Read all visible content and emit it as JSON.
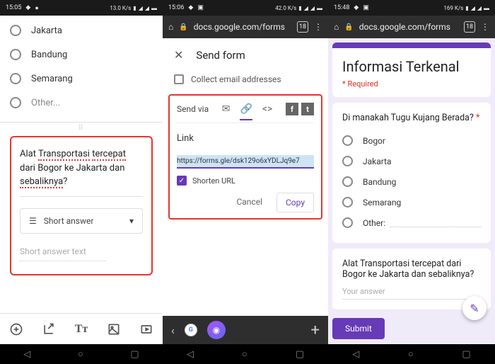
{
  "panel1": {
    "status_time": "15:05",
    "radios": [
      "Jakarta",
      "Bandung",
      "Semarang",
      "Other..."
    ],
    "question": {
      "pre": "Alat ",
      "w1": "Transportasi",
      "mid": " ",
      "w2": "tercepat",
      "post": " dari Bogor ke Jakarta dan ",
      "w3": "sebaliknya",
      "end": "?"
    },
    "type_label": "Short answer",
    "sa_placeholder": "Short answer text"
  },
  "panel2": {
    "status_time": "15:06",
    "url": "docs.google.com/forms",
    "tab_count": "18",
    "send_form": "Send form",
    "collect": "Collect email addresses",
    "send_via": "Send via",
    "link_label": "Link",
    "link_value": "https://forms.gle/dsk129o6xYDLJq9e7",
    "shorten": "Shorten URL",
    "cancel": "Cancel",
    "copy": "Copy"
  },
  "panel3": {
    "status_time": "15:48",
    "url": "docs.google.com/forms",
    "tab_count": "18",
    "form_title": "Informasi Terkenal",
    "required": "* Required",
    "q1": "Di manakah Tugu Kujang Berada?",
    "q1_options": [
      "Bogor",
      "Jakarta",
      "Bandung",
      "Semarang"
    ],
    "q1_other": "Other:",
    "q2": "Alat Transportasi tercepat dari Bogor ke Jakarta dan sebaliknya?",
    "your_answer": "Your answer",
    "submit": "Submit"
  }
}
